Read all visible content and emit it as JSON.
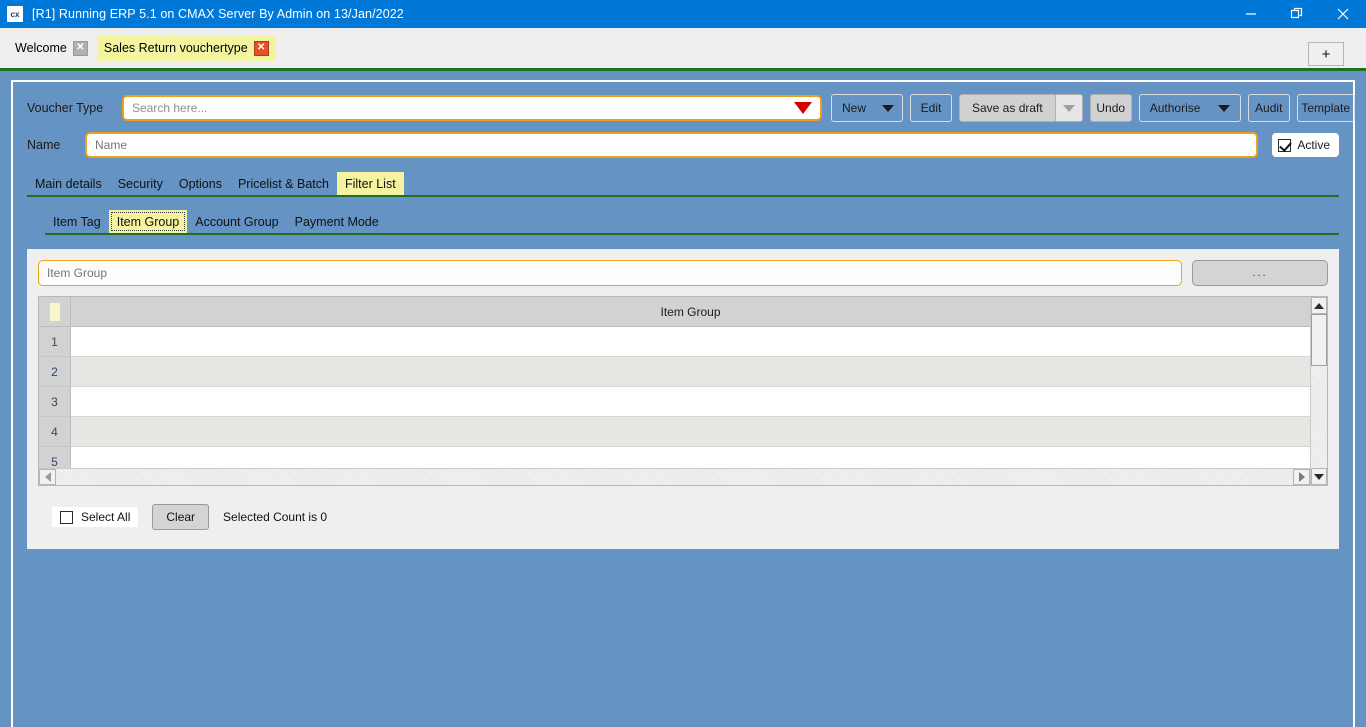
{
  "titlebar": {
    "logo_text": "cx",
    "title": "[R1] Running ERP 5.1 on CMAX Server By Admin on 13/Jan/2022",
    "minimize": "—",
    "maximize": "❐",
    "close": "✕"
  },
  "tabstrip": {
    "tabs": [
      {
        "label": "Welcome",
        "close": "✕",
        "active": false
      },
      {
        "label": "Sales Return vouchertype",
        "close": "✕",
        "active": true
      }
    ],
    "add_label": "+"
  },
  "form": {
    "voucher_type_label": "Voucher Type",
    "voucher_type_placeholder": "Search here...",
    "voucher_type_value": "",
    "name_label": "Name",
    "name_placeholder": "Name",
    "name_value": "",
    "active_label": "Active",
    "active_checked": true
  },
  "toolbar": {
    "new_label": "New",
    "edit_label": "Edit",
    "save_as_draft_label": "Save as draft",
    "undo_label": "Undo",
    "authorise_label": "Authorise",
    "audit_label": "Audit",
    "template_label": "Template"
  },
  "main_tabs": [
    {
      "label": "Main details",
      "selected": false
    },
    {
      "label": "Security",
      "selected": false
    },
    {
      "label": "Options",
      "selected": false
    },
    {
      "label": "Pricelist & Batch",
      "selected": false
    },
    {
      "label": "Filter List",
      "selected": true
    }
  ],
  "sub_tabs": [
    {
      "label": "Item Tag",
      "selected": false
    },
    {
      "label": "Item Group",
      "selected": true
    },
    {
      "label": "Account Group",
      "selected": false
    },
    {
      "label": "Payment Mode",
      "selected": false
    }
  ],
  "panel": {
    "search_placeholder": "Item Group",
    "search_value": "",
    "ellipsis_label": "...",
    "grid": {
      "column_header": "Item Group",
      "rows": [
        {
          "num": "1",
          "value": ""
        },
        {
          "num": "2",
          "value": ""
        },
        {
          "num": "3",
          "value": ""
        },
        {
          "num": "4",
          "value": ""
        },
        {
          "num": "5",
          "value": ""
        }
      ]
    },
    "footer": {
      "select_all_label": "Select All",
      "select_all_checked": false,
      "clear_label": "Clear",
      "selected_count_text": "Selected Count is 0"
    }
  },
  "colors": {
    "title_bar": "#0078d7",
    "workspace": "#6594c4",
    "accent_border": "#f0a018",
    "tab_highlight": "#f4f4a0",
    "green_rule": "#1f6f25",
    "caret_red": "#d40000"
  }
}
